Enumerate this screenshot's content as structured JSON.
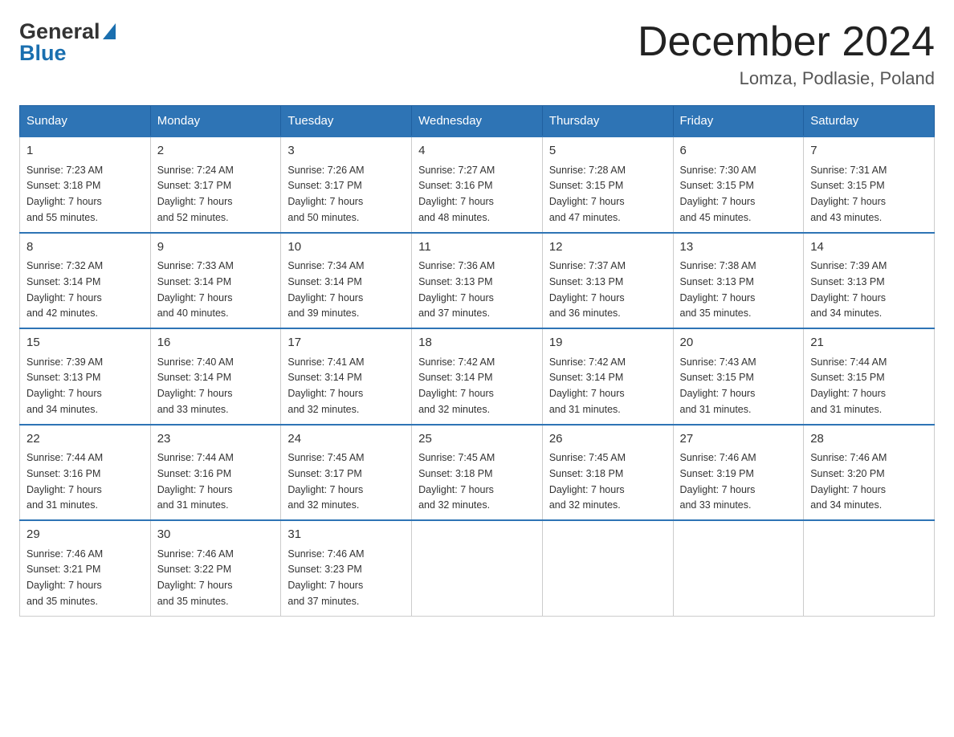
{
  "header": {
    "logo_general": "General",
    "logo_blue": "Blue",
    "month_title": "December 2024",
    "location": "Lomza, Podlasie, Poland"
  },
  "weekdays": [
    "Sunday",
    "Monday",
    "Tuesday",
    "Wednesday",
    "Thursday",
    "Friday",
    "Saturday"
  ],
  "weeks": [
    [
      {
        "day": "1",
        "sunrise": "7:23 AM",
        "sunset": "3:18 PM",
        "daylight": "7 hours and 55 minutes."
      },
      {
        "day": "2",
        "sunrise": "7:24 AM",
        "sunset": "3:17 PM",
        "daylight": "7 hours and 52 minutes."
      },
      {
        "day": "3",
        "sunrise": "7:26 AM",
        "sunset": "3:17 PM",
        "daylight": "7 hours and 50 minutes."
      },
      {
        "day": "4",
        "sunrise": "7:27 AM",
        "sunset": "3:16 PM",
        "daylight": "7 hours and 48 minutes."
      },
      {
        "day": "5",
        "sunrise": "7:28 AM",
        "sunset": "3:15 PM",
        "daylight": "7 hours and 47 minutes."
      },
      {
        "day": "6",
        "sunrise": "7:30 AM",
        "sunset": "3:15 PM",
        "daylight": "7 hours and 45 minutes."
      },
      {
        "day": "7",
        "sunrise": "7:31 AM",
        "sunset": "3:15 PM",
        "daylight": "7 hours and 43 minutes."
      }
    ],
    [
      {
        "day": "8",
        "sunrise": "7:32 AM",
        "sunset": "3:14 PM",
        "daylight": "7 hours and 42 minutes."
      },
      {
        "day": "9",
        "sunrise": "7:33 AM",
        "sunset": "3:14 PM",
        "daylight": "7 hours and 40 minutes."
      },
      {
        "day": "10",
        "sunrise": "7:34 AM",
        "sunset": "3:14 PM",
        "daylight": "7 hours and 39 minutes."
      },
      {
        "day": "11",
        "sunrise": "7:36 AM",
        "sunset": "3:13 PM",
        "daylight": "7 hours and 37 minutes."
      },
      {
        "day": "12",
        "sunrise": "7:37 AM",
        "sunset": "3:13 PM",
        "daylight": "7 hours and 36 minutes."
      },
      {
        "day": "13",
        "sunrise": "7:38 AM",
        "sunset": "3:13 PM",
        "daylight": "7 hours and 35 minutes."
      },
      {
        "day": "14",
        "sunrise": "7:39 AM",
        "sunset": "3:13 PM",
        "daylight": "7 hours and 34 minutes."
      }
    ],
    [
      {
        "day": "15",
        "sunrise": "7:39 AM",
        "sunset": "3:13 PM",
        "daylight": "7 hours and 34 minutes."
      },
      {
        "day": "16",
        "sunrise": "7:40 AM",
        "sunset": "3:14 PM",
        "daylight": "7 hours and 33 minutes."
      },
      {
        "day": "17",
        "sunrise": "7:41 AM",
        "sunset": "3:14 PM",
        "daylight": "7 hours and 32 minutes."
      },
      {
        "day": "18",
        "sunrise": "7:42 AM",
        "sunset": "3:14 PM",
        "daylight": "7 hours and 32 minutes."
      },
      {
        "day": "19",
        "sunrise": "7:42 AM",
        "sunset": "3:14 PM",
        "daylight": "7 hours and 31 minutes."
      },
      {
        "day": "20",
        "sunrise": "7:43 AM",
        "sunset": "3:15 PM",
        "daylight": "7 hours and 31 minutes."
      },
      {
        "day": "21",
        "sunrise": "7:44 AM",
        "sunset": "3:15 PM",
        "daylight": "7 hours and 31 minutes."
      }
    ],
    [
      {
        "day": "22",
        "sunrise": "7:44 AM",
        "sunset": "3:16 PM",
        "daylight": "7 hours and 31 minutes."
      },
      {
        "day": "23",
        "sunrise": "7:44 AM",
        "sunset": "3:16 PM",
        "daylight": "7 hours and 31 minutes."
      },
      {
        "day": "24",
        "sunrise": "7:45 AM",
        "sunset": "3:17 PM",
        "daylight": "7 hours and 32 minutes."
      },
      {
        "day": "25",
        "sunrise": "7:45 AM",
        "sunset": "3:18 PM",
        "daylight": "7 hours and 32 minutes."
      },
      {
        "day": "26",
        "sunrise": "7:45 AM",
        "sunset": "3:18 PM",
        "daylight": "7 hours and 32 minutes."
      },
      {
        "day": "27",
        "sunrise": "7:46 AM",
        "sunset": "3:19 PM",
        "daylight": "7 hours and 33 minutes."
      },
      {
        "day": "28",
        "sunrise": "7:46 AM",
        "sunset": "3:20 PM",
        "daylight": "7 hours and 34 minutes."
      }
    ],
    [
      {
        "day": "29",
        "sunrise": "7:46 AM",
        "sunset": "3:21 PM",
        "daylight": "7 hours and 35 minutes."
      },
      {
        "day": "30",
        "sunrise": "7:46 AM",
        "sunset": "3:22 PM",
        "daylight": "7 hours and 35 minutes."
      },
      {
        "day": "31",
        "sunrise": "7:46 AM",
        "sunset": "3:23 PM",
        "daylight": "7 hours and 37 minutes."
      },
      null,
      null,
      null,
      null
    ]
  ],
  "labels": {
    "sunrise": "Sunrise:",
    "sunset": "Sunset:",
    "daylight": "Daylight:"
  }
}
